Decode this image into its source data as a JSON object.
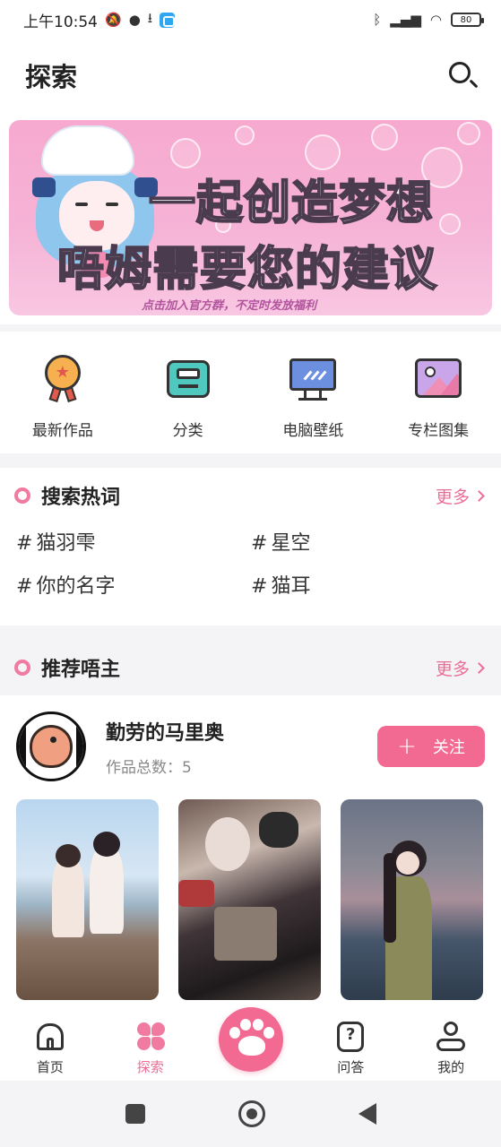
{
  "status_bar": {
    "time": "上午10:54",
    "battery": "80",
    "icons": [
      "mute-icon",
      "chat-icon",
      "download-icon",
      "app-icon",
      "bluetooth-icon",
      "signal-icon",
      "wifi-icon",
      "battery-icon"
    ]
  },
  "header": {
    "title": "探索",
    "search_icon": "search-icon"
  },
  "banner": {
    "line1": "一起创造梦想",
    "line2": "唔姆需要您的建议",
    "line3": "点击加入官方群，不定时发放福利"
  },
  "quick_nav": [
    {
      "label": "最新作品",
      "icon": "medal-icon"
    },
    {
      "label": "分类",
      "icon": "tray-icon"
    },
    {
      "label": "电脑壁纸",
      "icon": "monitor-icon"
    },
    {
      "label": "专栏图集",
      "icon": "picture-icon"
    }
  ],
  "hot_search": {
    "title": "搜索热词",
    "more": "更多",
    "hash": "#",
    "items": [
      "猫羽雫",
      "星空",
      "你的名字",
      "猫耳"
    ]
  },
  "recommend": {
    "title": "推荐唔主",
    "more": "更多",
    "uploader": {
      "name": "勤劳的马里奥",
      "count": "作品总数：5",
      "follow_plus": "+",
      "follow_label": "关注"
    },
    "thumbnails": [
      "photo-beach",
      "art-mecha",
      "art-girl-sea"
    ]
  },
  "bottom_nav": [
    {
      "label": "首页",
      "icon": "home-icon",
      "active": false
    },
    {
      "label": "探索",
      "icon": "explore-icon",
      "active": true
    },
    {
      "label": "问答",
      "icon": "question-icon",
      "active": false
    },
    {
      "label": "我的",
      "icon": "profile-icon",
      "active": false
    }
  ],
  "colors": {
    "accent": "#f26a92",
    "more_text": "#ec6d95",
    "background": "#f4f4f6"
  }
}
